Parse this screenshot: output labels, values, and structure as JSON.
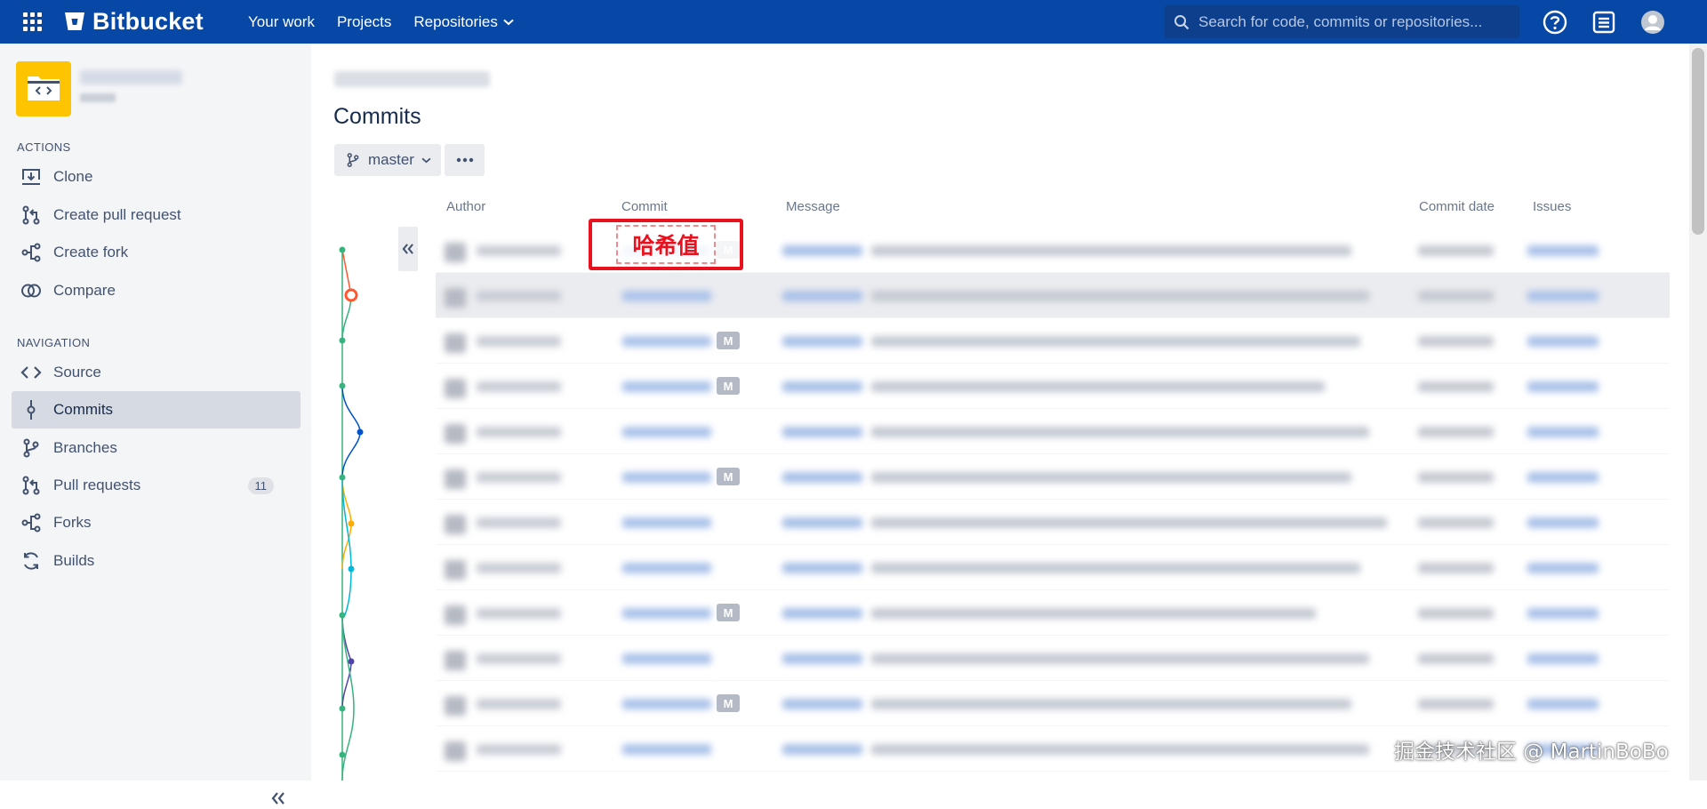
{
  "app": {
    "name": "Bitbucket"
  },
  "topnav": {
    "links": [
      {
        "label": "Your work"
      },
      {
        "label": "Projects"
      },
      {
        "label": "Repositories"
      }
    ],
    "search_placeholder": "Search for code, commits or repositories..."
  },
  "sidebar": {
    "actions_label": "ACTIONS",
    "actions": [
      {
        "label": "Clone",
        "icon": "clone-icon"
      },
      {
        "label": "Create pull request",
        "icon": "pull-request-icon"
      },
      {
        "label": "Create fork",
        "icon": "fork-icon"
      },
      {
        "label": "Compare",
        "icon": "compare-icon"
      }
    ],
    "navigation_label": "NAVIGATION",
    "navigation": [
      {
        "label": "Source",
        "icon": "source-icon"
      },
      {
        "label": "Commits",
        "icon": "commit-icon",
        "active": true
      },
      {
        "label": "Branches",
        "icon": "branch-icon"
      },
      {
        "label": "Pull requests",
        "icon": "pull-request-icon",
        "badge": "11"
      },
      {
        "label": "Forks",
        "icon": "fork-icon"
      },
      {
        "label": "Builds",
        "icon": "builds-icon"
      }
    ]
  },
  "main": {
    "title": "Commits",
    "branch": "master",
    "columns": {
      "author": "Author",
      "commit": "Commit",
      "message": "Message",
      "date": "Commit date",
      "issues": "Issues"
    },
    "merge_badge": "M",
    "rows": [
      {
        "merge": true
      },
      {
        "merge": false,
        "highlight": true
      },
      {
        "merge": true
      },
      {
        "merge": true
      },
      {
        "merge": false
      },
      {
        "merge": true
      },
      {
        "merge": false
      },
      {
        "merge": false
      },
      {
        "merge": true
      },
      {
        "merge": false
      },
      {
        "merge": true
      },
      {
        "merge": false
      }
    ]
  },
  "annotation": {
    "label": "哈希值"
  },
  "watermark": "掘金技术社区 @ MartinBoBo",
  "colors": {
    "topbar": "#0747a6",
    "sidebar": "#f4f5f7",
    "repo_avatar": "#ffc400",
    "annotation": "#e8121f"
  }
}
